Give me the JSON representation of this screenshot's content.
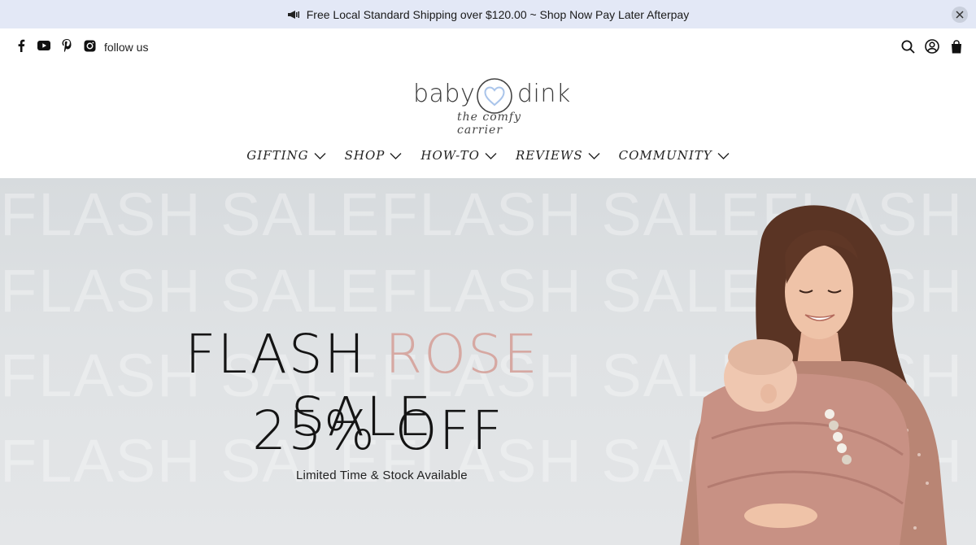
{
  "announcement": {
    "text": "Free Local Standard Shipping over $120.00 ~ Shop Now Pay Later Afterpay",
    "icon": "megaphone-icon"
  },
  "header": {
    "follow_label": "follow us",
    "social_icons": [
      "facebook-icon",
      "youtube-icon",
      "pinterest-icon",
      "instagram-icon"
    ],
    "utility_icons": [
      "search-icon",
      "account-icon",
      "cart-icon"
    ]
  },
  "logo": {
    "word_left": "baby",
    "word_right": "dink",
    "tagline": "the comfy carrier"
  },
  "nav": {
    "items": [
      {
        "label": "GIFTING"
      },
      {
        "label": "SHOP"
      },
      {
        "label": "HOW-TO"
      },
      {
        "label": "REVIEWS"
      },
      {
        "label": "COMMUNITY"
      }
    ]
  },
  "hero": {
    "watermark": "FLASH SALEFLASH SALEFLASH SA",
    "headline_part1": "FLASH ",
    "headline_accent": "ROSE",
    "headline_part2": " SALE",
    "discount": "25% OFF",
    "subtext": "Limited Time & Stock Available",
    "colors": {
      "accent": "#d6a8a2",
      "background": "#dfe2e4",
      "announcement_bg": "#e3e8f6"
    }
  }
}
